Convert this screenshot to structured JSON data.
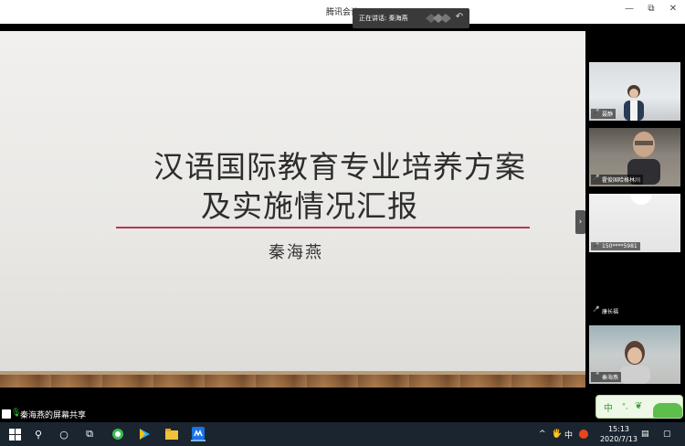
{
  "window": {
    "title": "腾讯会议",
    "controls": [
      "—",
      "⧉",
      "✕"
    ]
  },
  "speaking": {
    "label": "正在讲话: 秦海燕"
  },
  "slide": {
    "title_line1": "汉语国际教育专业培养方案",
    "title_line2": "及实施情况汇报",
    "author": "秦海燕",
    "rule_color": "#b8365b"
  },
  "share_bar": {
    "label": "秦海燕的屏幕共享"
  },
  "participants": [
    {
      "name": "聂静"
    },
    {
      "name": "霍俊国哈格林川"
    },
    {
      "name": "150****5981"
    },
    {
      "name": "康长福"
    },
    {
      "name": "秦海燕"
    }
  ],
  "ime": {
    "char": "中"
  },
  "taskbar": {
    "icons": [
      "windows-start-icon",
      "search-icon",
      "cortana-icon",
      "task-view-icon",
      "360-browser-icon",
      "media-player-icon",
      "file-explorer-icon",
      "tencent-meeting-icon"
    ],
    "tray_caret": "^",
    "tray_ime": "中",
    "time": "15:13",
    "date": "2020/7/13"
  }
}
